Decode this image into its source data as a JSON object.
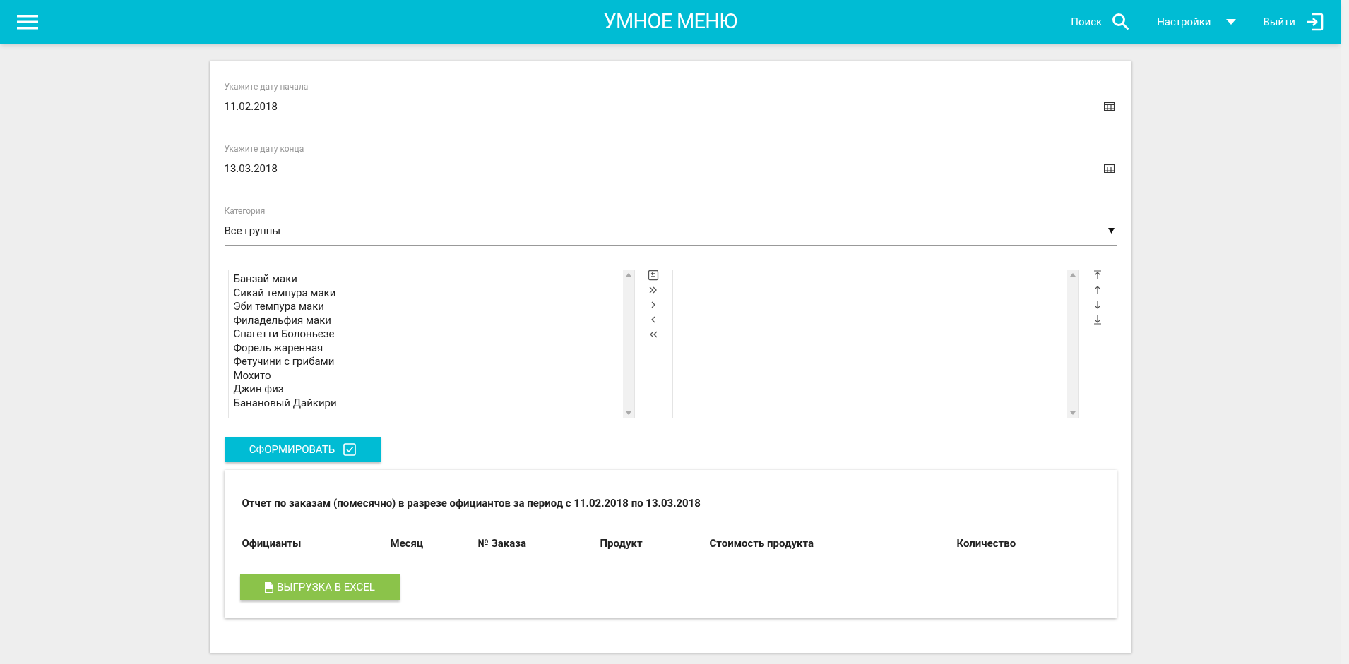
{
  "header": {
    "title": "УМНОЕ МЕНЮ",
    "actions": [
      {
        "kind": "search",
        "label": "Поиск"
      },
      {
        "kind": "dropdown",
        "label": "Настройки"
      },
      {
        "kind": "logout",
        "label": "Выйти"
      }
    ]
  },
  "fields": [
    {
      "kind": "date",
      "label": "Укажите дату начала",
      "value": "11.02.2018"
    },
    {
      "kind": "date",
      "label": "Укажите дату конца",
      "value": "13.03.2018"
    },
    {
      "kind": "select",
      "label": "Категория",
      "value": "Все группы"
    }
  ],
  "available_items": [
    "Банзай маки",
    "Сикай темпура маки",
    "Эби темпура маки",
    "Филадельфия маки",
    "Спагетти Болоньезе",
    "Форель жаренная",
    "Фетучини с грибами",
    "Мохито",
    "Джин физ",
    "Банановый Дайкири"
  ],
  "submit_button": "СФОРМИРОВАТЬ",
  "report": {
    "title": "Отчет по заказам (помесячно) в разрезе официантов за период с 11.02.2018 по 13.03.2018",
    "columns": [
      "Официанты",
      "Месяц",
      "№ Заказа",
      "Продукт",
      "Стоимость продукта",
      "Количество"
    ],
    "export_button": "ВЫГРУЗКА В EXCEL"
  }
}
